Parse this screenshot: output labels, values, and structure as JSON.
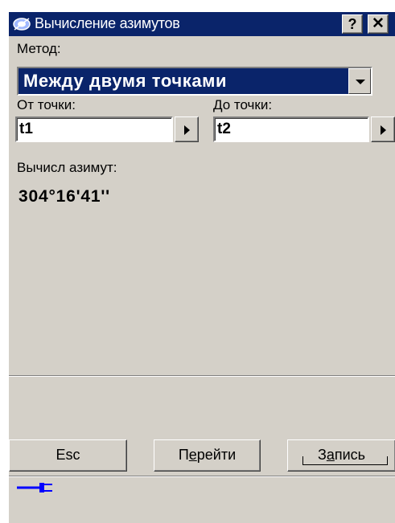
{
  "window": {
    "title": "Вычисление азимутов",
    "help_label": "?",
    "close_label": "✕"
  },
  "method": {
    "label": "Метод:",
    "value": "Между двумя точками"
  },
  "from_point": {
    "label": "От точки:",
    "value": "t1"
  },
  "to_point": {
    "label": "До точки:",
    "value": "t2"
  },
  "result": {
    "label": "Вычисл азимут:",
    "value": "304°16'41''"
  },
  "buttons": {
    "esc": "Esc",
    "go_pre": "П",
    "go_u": "е",
    "go_post": "рейти",
    "save_pre": "З",
    "save_u": "а",
    "save_post": "пись"
  },
  "colors": {
    "titlebar": "#0a246a",
    "selection": "#0a246a",
    "window_bg": "#d4d0c8",
    "plug": "#0000ff"
  },
  "icons": {
    "title": "app-satellite-icon",
    "status": "power-plug-icon"
  }
}
